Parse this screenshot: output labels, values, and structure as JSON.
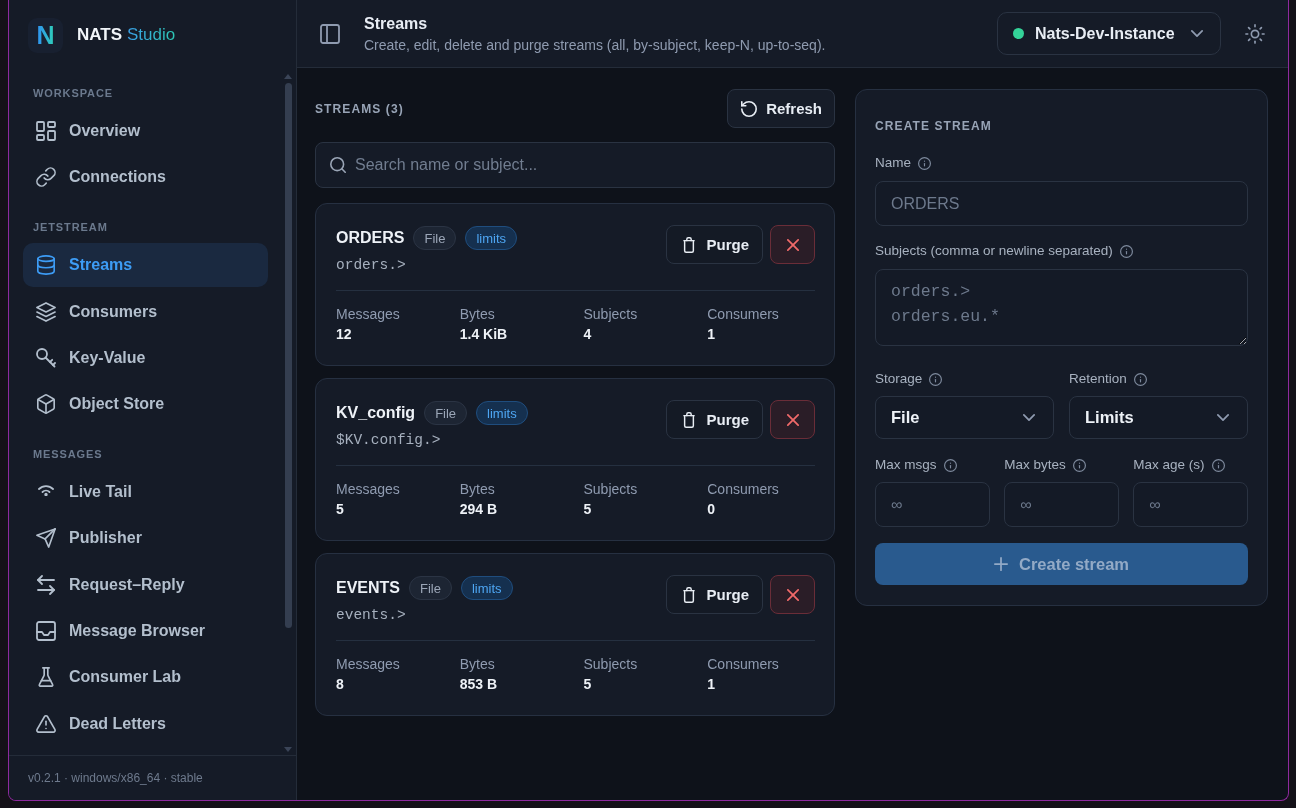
{
  "brand": {
    "mark": "N",
    "name": "NATS",
    "suffix": "Studio"
  },
  "sidebar": {
    "sections": [
      {
        "label": "WORKSPACE",
        "items": [
          {
            "label": "Overview",
            "selected": false
          },
          {
            "label": "Connections",
            "selected": false
          }
        ]
      },
      {
        "label": "JETSTREAM",
        "items": [
          {
            "label": "Streams",
            "selected": true
          },
          {
            "label": "Consumers",
            "selected": false
          },
          {
            "label": "Key-Value",
            "selected": false
          },
          {
            "label": "Object Store",
            "selected": false
          }
        ]
      },
      {
        "label": "MESSAGES",
        "items": [
          {
            "label": "Live Tail",
            "selected": false
          },
          {
            "label": "Publisher",
            "selected": false
          },
          {
            "label": "Request–Reply",
            "selected": false
          },
          {
            "label": "Message Browser",
            "selected": false
          },
          {
            "label": "Consumer Lab",
            "selected": false
          },
          {
            "label": "Dead Letters",
            "selected": false
          }
        ]
      }
    ],
    "footer": "v0.2.1 · windows/x86_64 · stable"
  },
  "header": {
    "title": "Streams",
    "subtitle": "Create, edit, delete and purge streams (all, by-subject, keep-N, up-to-seq).",
    "connection": {
      "name": "Nats-Dev-Instance",
      "connected": true
    }
  },
  "streams_panel": {
    "title": "STREAMS (3)",
    "refresh_button": "Refresh",
    "search": {
      "placeholder": "Search name or subject..."
    },
    "streams": [
      {
        "name": "ORDERS",
        "storage": "File",
        "retention": "limits",
        "subject": "orders.>",
        "purge_button": "Purge",
        "stats": [
          {
            "label": "Messages",
            "value": "12"
          },
          {
            "label": "Bytes",
            "value": "1.4 KiB"
          },
          {
            "label": "Subjects",
            "value": "4"
          },
          {
            "label": "Consumers",
            "value": "1"
          }
        ]
      },
      {
        "name": "KV_config",
        "storage": "File",
        "retention": "limits",
        "subject": "$KV.config.>",
        "purge_button": "Purge",
        "stats": [
          {
            "label": "Messages",
            "value": "5"
          },
          {
            "label": "Bytes",
            "value": "294 B"
          },
          {
            "label": "Subjects",
            "value": "5"
          },
          {
            "label": "Consumers",
            "value": "0"
          }
        ]
      },
      {
        "name": "EVENTS",
        "storage": "File",
        "retention": "limits",
        "subject": "events.>",
        "purge_button": "Purge",
        "stats": [
          {
            "label": "Messages",
            "value": "8"
          },
          {
            "label": "Bytes",
            "value": "853 B"
          },
          {
            "label": "Subjects",
            "value": "5"
          },
          {
            "label": "Consumers",
            "value": "1"
          }
        ]
      }
    ]
  },
  "create_stream": {
    "title": "CREATE STREAM",
    "name_field": {
      "label": "Name",
      "placeholder": "ORDERS"
    },
    "subjects_field": {
      "label": "Subjects (comma or newline separated)",
      "placeholder": "orders.>\norders.eu.*"
    },
    "storage_select": {
      "label": "Storage",
      "value": "File"
    },
    "retention_select": {
      "label": "Retention",
      "value": "Limits"
    },
    "limit_fields": [
      {
        "label": "Max msgs",
        "placeholder": "∞"
      },
      {
        "label": "Max bytes",
        "placeholder": "∞"
      },
      {
        "label": "Max age (s)",
        "placeholder": "∞"
      }
    ],
    "create_button": {
      "label": "Create stream",
      "disabled": true
    }
  }
}
